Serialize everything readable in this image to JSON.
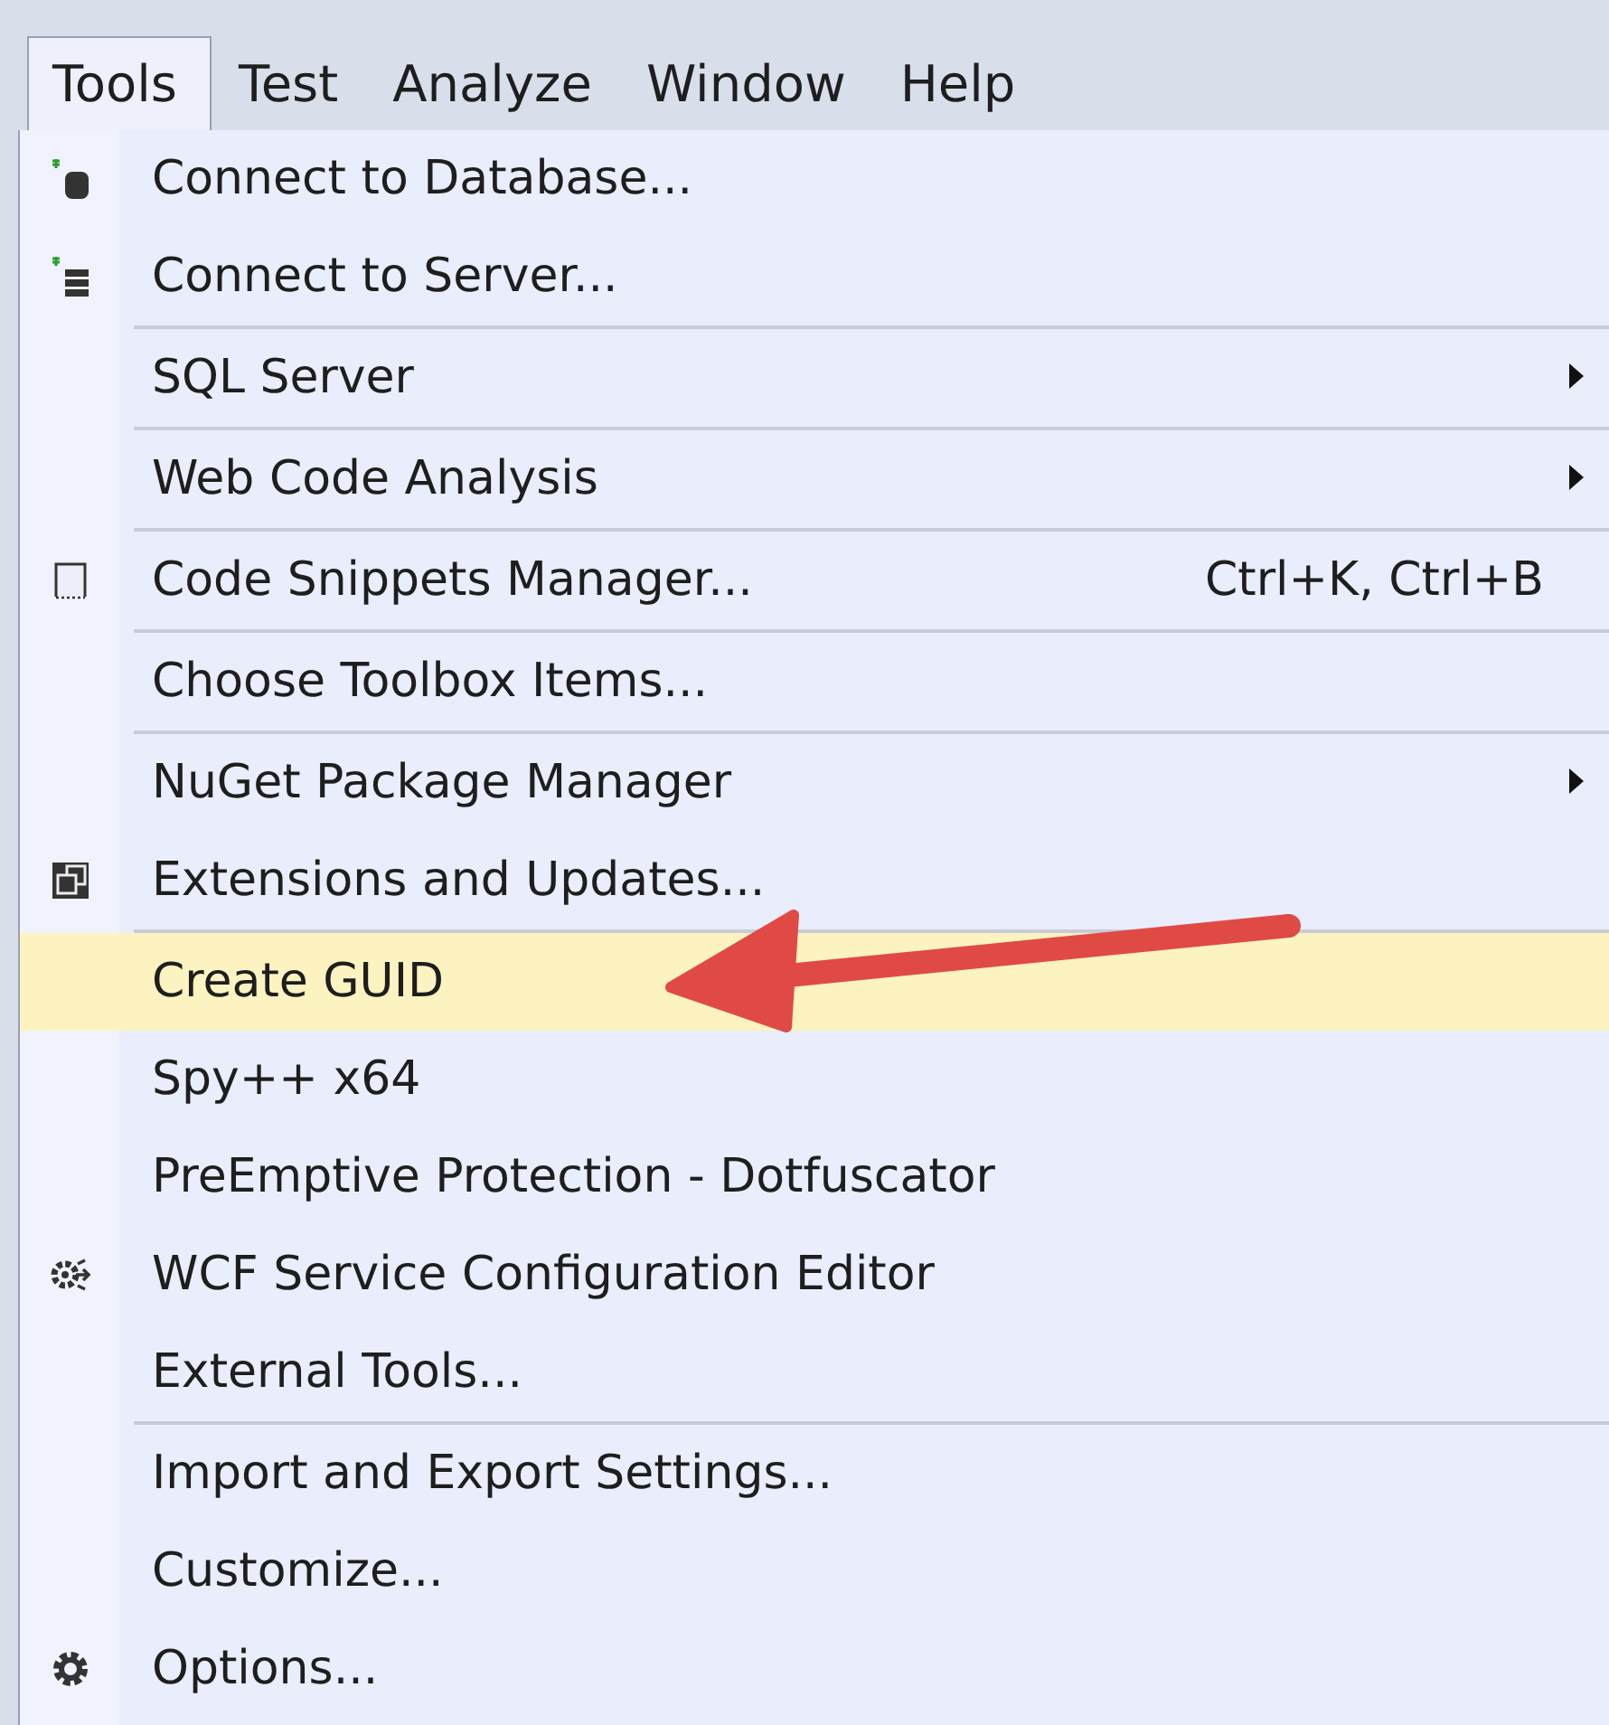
{
  "menu_bar": [
    {
      "label": "Tools",
      "selected": true
    },
    {
      "label": "Test",
      "selected": false
    },
    {
      "label": "Analyze",
      "selected": false
    },
    {
      "label": "Window",
      "selected": false
    },
    {
      "label": "Help",
      "selected": false
    }
  ],
  "menu_groups": [
    [
      {
        "label": "Connect to Database...",
        "submenu": false,
        "selected": false
      },
      {
        "label": "Connect to Server...",
        "submenu": false,
        "selected": false
      }
    ],
    [
      {
        "label": "SQL Server",
        "submenu": true,
        "selected": false
      }
    ],
    [
      {
        "label": "Web Code Analysis",
        "submenu": true,
        "selected": false
      }
    ],
    [
      {
        "label": "Code Snippets Manager...",
        "shortcut": "Ctrl+K, Ctrl+B",
        "submenu": false,
        "selected": false
      }
    ],
    [
      {
        "label": "Choose Toolbox Items...",
        "submenu": false,
        "selected": false
      }
    ],
    [
      {
        "label": "NuGet Package Manager",
        "submenu": true,
        "selected": false
      },
      {
        "label": "Extensions and Updates...",
        "submenu": false,
        "selected": false
      }
    ],
    [
      {
        "label": "Create GUID",
        "submenu": false,
        "selected": true
      },
      {
        "label": "Spy++ x64",
        "submenu": false,
        "selected": false
      },
      {
        "label": "PreEmptive Protection - Dotfuscator",
        "submenu": false,
        "selected": false
      },
      {
        "label": "WCF Service Configuration Editor",
        "submenu": false,
        "selected": false
      },
      {
        "label": "External Tools...",
        "submenu": false,
        "selected": false
      }
    ],
    [
      {
        "label": "Import and Export Settings...",
        "submenu": false,
        "selected": false
      },
      {
        "label": "Customize...",
        "submenu": false,
        "selected": false
      },
      {
        "label": "Options...",
        "submenu": false,
        "selected": false
      }
    ]
  ],
  "annotation": {
    "kind": "arrow"
  }
}
